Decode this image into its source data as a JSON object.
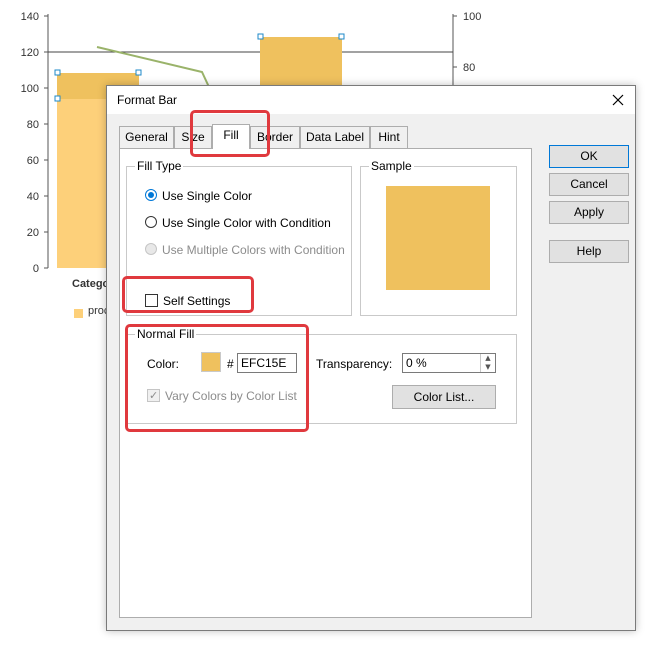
{
  "chart": {
    "left_ticks": [
      "140",
      "120",
      "100",
      "80",
      "60",
      "40",
      "20",
      "0"
    ],
    "right_ticks": [
      "100",
      "80"
    ],
    "category_label": "Catego",
    "legend_label": "proc",
    "bar_color": "#fdd07a",
    "bar_overlay_color": "#efc15e",
    "line_color": "#9ab36a"
  },
  "dialog": {
    "title": "Format Bar",
    "tabs": [
      "General",
      "Size",
      "Fill",
      "Border",
      "Data Label",
      "Hint"
    ],
    "active_tab": "Fill",
    "fill_type": {
      "title": "Fill Type",
      "options": [
        {
          "label": "Use Single Color",
          "checked": true,
          "disabled": false
        },
        {
          "label": "Use Single Color with Condition",
          "checked": false,
          "disabled": false
        },
        {
          "label": "Use Multiple Colors with Condition",
          "checked": false,
          "disabled": true
        }
      ]
    },
    "sample": {
      "title": "Sample",
      "color": "#EFC15E"
    },
    "self_settings": {
      "label": "Self Settings",
      "checked": false
    },
    "normal_fill": {
      "title": "Normal Fill",
      "color_label": "Color:",
      "hash": "#",
      "color_value": "EFC15E",
      "transparency_label": "Transparency:",
      "transparency_value": "0 %",
      "vary_colors_label": "Vary Colors by Color List",
      "vary_colors_checked": true,
      "color_list_button": "Color List..."
    },
    "buttons": {
      "ok": "OK",
      "cancel": "Cancel",
      "apply": "Apply",
      "help": "Help"
    }
  },
  "colors": {
    "highlight": "#e0393e",
    "accent": "#0078d7"
  }
}
